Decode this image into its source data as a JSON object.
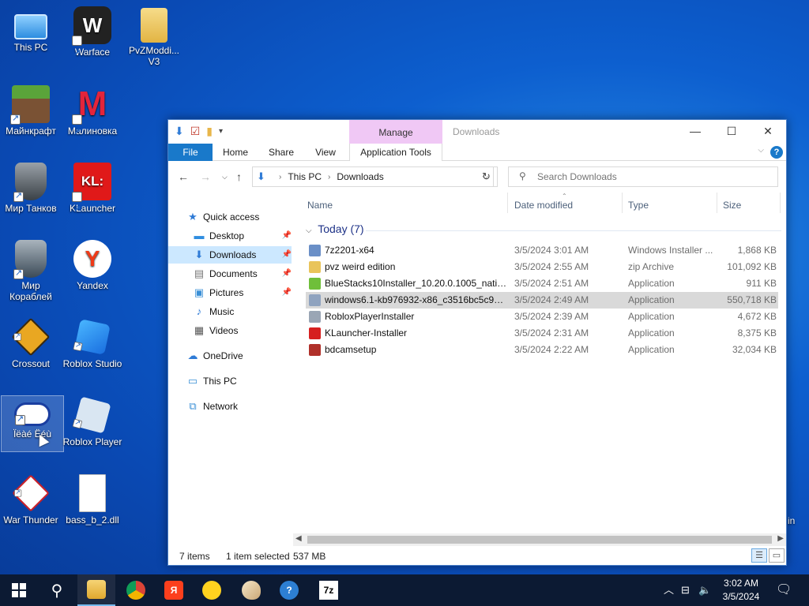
{
  "desktop": {
    "icons": [
      {
        "label": "This PC"
      },
      {
        "label": "Warface"
      },
      {
        "label": "PvZModdi... V3"
      },
      {
        "label": "Майнкрафт"
      },
      {
        "label": "Малиновка"
      },
      {
        "label": "Мир Танков"
      },
      {
        "label": "KLauncher"
      },
      {
        "label": "Мир Кораблей"
      },
      {
        "label": "Yandex"
      },
      {
        "label": "Crossout"
      },
      {
        "label": "Roblox Studio"
      },
      {
        "label": "Ïëàé Ëéù"
      },
      {
        "label": "Roblox Player"
      },
      {
        "label": "War Thunder"
      },
      {
        "label": "bass_b_2.dll"
      }
    ],
    "partial_icon_text": "in"
  },
  "window": {
    "title": "Downloads",
    "manage_tab": "Manage",
    "ribbon_tabs": {
      "file": "File",
      "home": "Home",
      "share": "Share",
      "view": "View",
      "app_tools": "Application Tools"
    },
    "address": {
      "root": "This PC",
      "current": "Downloads"
    },
    "search": {
      "placeholder": "Search Downloads"
    },
    "nav": {
      "quick_access": "Quick access",
      "desktop": "Desktop",
      "downloads": "Downloads",
      "documents": "Documents",
      "pictures": "Pictures",
      "music": "Music",
      "videos": "Videos",
      "onedrive": "OneDrive",
      "this_pc": "This PC",
      "network": "Network"
    },
    "columns": {
      "name": "Name",
      "date": "Date modified",
      "type": "Type",
      "size": "Size"
    },
    "group_label": "Today (7)",
    "files": [
      {
        "name": "7z2201-x64",
        "date": "3/5/2024 3:01 AM",
        "type": "Windows Installer ...",
        "size": "1,868 KB",
        "color": "#6a8fc7"
      },
      {
        "name": "pvz weird edition",
        "date": "3/5/2024 2:55 AM",
        "type": "zip Archive",
        "size": "101,092 KB",
        "color": "#e9c45a"
      },
      {
        "name": "BlueStacks10Installer_10.20.0.1005_native...",
        "date": "3/5/2024 2:51 AM",
        "type": "Application",
        "size": "911 KB",
        "color": "#6fbf3a"
      },
      {
        "name": "windows6.1-kb976932-x86_c3516bc5c9e6...",
        "date": "3/5/2024 2:49 AM",
        "type": "Application",
        "size": "550,718 KB",
        "color": "#8fa3bf"
      },
      {
        "name": "RobloxPlayerInstaller",
        "date": "3/5/2024 2:39 AM",
        "type": "Application",
        "size": "4,672 KB",
        "color": "#9aa6b5"
      },
      {
        "name": "KLauncher-Installer",
        "date": "3/5/2024 2:31 AM",
        "type": "Application",
        "size": "8,375 KB",
        "color": "#d62020"
      },
      {
        "name": "bdcamsetup",
        "date": "3/5/2024 2:22 AM",
        "type": "Application",
        "size": "32,034 KB",
        "color": "#b0302a"
      }
    ],
    "status": {
      "items": "7 items",
      "selected": "1 item selected",
      "size": "537 MB"
    }
  },
  "taskbar": {
    "yandex": "Я",
    "zip": "7z",
    "time": "3:02 AM",
    "date": "3/5/2024"
  },
  "colors": {
    "accent": "#1979ca",
    "selection": "#cce8ff",
    "taskbar": "#0c1a33",
    "manage": "#f0c8f5"
  }
}
